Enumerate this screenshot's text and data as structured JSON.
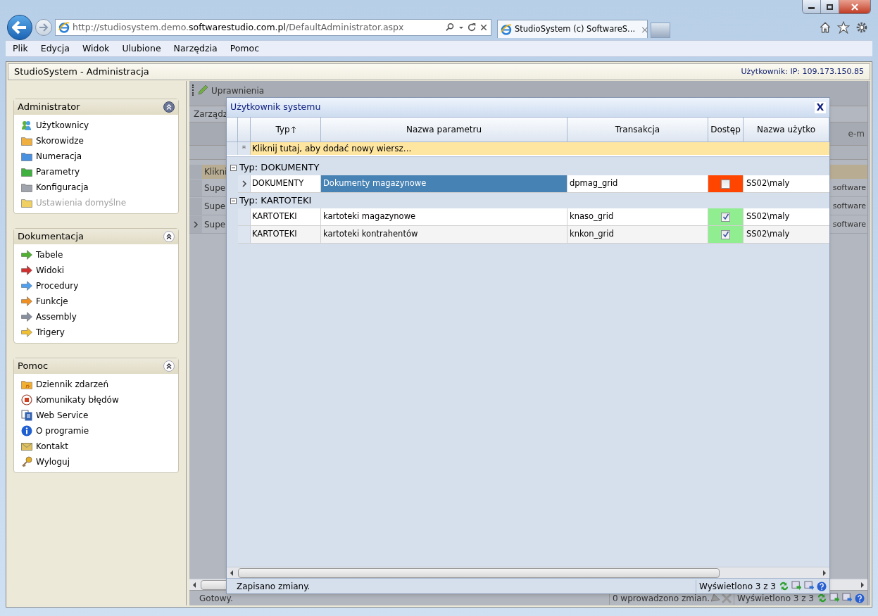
{
  "browser": {
    "address": {
      "prefix": "http://studiosystem.demo.",
      "domain": "softwarestudio.com.pl",
      "suffix": "/DefaultAdministrator.aspx"
    },
    "tab_title": "StudioSystem (c) SoftwareS...",
    "tab_close": "×",
    "menu": [
      "Plik",
      "Edycja",
      "Widok",
      "Ulubione",
      "Narzędzia",
      "Pomoc"
    ]
  },
  "app": {
    "title": "StudioSystem - Administracja",
    "user_info": "Użytkownik: IP: 109.173.150.85"
  },
  "sidebar": {
    "panels": [
      {
        "title": "Administrator",
        "highlighted": true,
        "items": [
          {
            "label": "Użytkownicy",
            "kind": "users",
            "color": "#4aa0e0",
            "disabled": false
          },
          {
            "label": "Skorowidze",
            "kind": "folder",
            "color": "#f0b040",
            "disabled": false
          },
          {
            "label": "Numeracja",
            "kind": "folder",
            "color": "#4a90e0",
            "disabled": false
          },
          {
            "label": "Parametry",
            "kind": "folder",
            "color": "#40b040",
            "disabled": false
          },
          {
            "label": "Konfiguracja",
            "kind": "folder",
            "color": "#a0a4ac",
            "disabled": false
          },
          {
            "label": "Ustawienia domyślne",
            "kind": "folder",
            "color": "#f0d060",
            "disabled": true
          }
        ]
      },
      {
        "title": "Dokumentacja",
        "highlighted": false,
        "items": [
          {
            "label": "Tabele",
            "kind": "arrow",
            "color": "#50b030",
            "disabled": false
          },
          {
            "label": "Widoki",
            "kind": "arrow",
            "color": "#d03030",
            "disabled": false
          },
          {
            "label": "Procedury",
            "kind": "arrow",
            "color": "#50a0f0",
            "disabled": false
          },
          {
            "label": "Funkcje",
            "kind": "arrow",
            "color": "#f09020",
            "disabled": false
          },
          {
            "label": "Assembly",
            "kind": "arrow",
            "color": "#8890a0",
            "disabled": false
          },
          {
            "label": "Trigery",
            "kind": "arrow",
            "color": "#f0c030",
            "disabled": false
          }
        ]
      },
      {
        "title": "Pomoc",
        "highlighted": false,
        "items": [
          {
            "label": "Dziennik zdarzeń",
            "kind": "feed",
            "color": "#f0b030",
            "disabled": false
          },
          {
            "label": "Komunikaty błędów",
            "kind": "stop",
            "color": "#d04020",
            "disabled": false
          },
          {
            "label": "Web Service",
            "kind": "pages",
            "color": "#3060b0",
            "disabled": false
          },
          {
            "label": "O programie",
            "kind": "info",
            "color": "#2060d0",
            "disabled": false
          },
          {
            "label": "Kontakt",
            "kind": "mail",
            "color": "#e0c060",
            "disabled": false
          },
          {
            "label": "Wyloguj",
            "kind": "key",
            "color": "#e0b020",
            "disabled": false
          }
        ]
      }
    ]
  },
  "background_grid": {
    "toolbar_button": "Uprawnienia",
    "group_text": "Zarządz",
    "header_text": "e-m",
    "new_row_text": "Klikni",
    "rows": [
      {
        "column_1": "Supe",
        "column_2": "software",
        "current": false
      },
      {
        "column_1": "Supe",
        "column_2": "software",
        "current": false
      },
      {
        "column_1": "Supe",
        "column_2": "software",
        "current": true
      }
    ],
    "status": "Gotowy.",
    "changes": "0 wprowadzono zmian.",
    "count": "Wyświetlono 3 z 3"
  },
  "dialog": {
    "title": "Użytkownik systemu",
    "close": "X",
    "columns": [
      {
        "label": "Typ",
        "sorted": true
      },
      {
        "label": "Nazwa parametru",
        "sorted": false
      },
      {
        "label": "Transakcja",
        "sorted": false
      },
      {
        "label": "Dostęp",
        "sorted": false
      },
      {
        "label": "Nazwa użytko",
        "sorted": false
      }
    ],
    "new_row_marker": "*",
    "new_row_text": "Kliknij tutaj, aby dodać nowy wiersz...",
    "groups": [
      {
        "label": "Typ: DOKUMENTY",
        "expanded": true,
        "rows": [
          {
            "type": "DOKUMENTY",
            "name": "Dokumenty magazynowe",
            "transaction": "dpmag_grid",
            "access": false,
            "user": "SS02\\maly",
            "current": true,
            "name_selected": true
          }
        ]
      },
      {
        "label": "Typ: KARTOTEKI",
        "expanded": true,
        "rows": [
          {
            "type": "KARTOTEKI",
            "name": "kartoteki magazynowe",
            "transaction": "knaso_grid",
            "access": true,
            "user": "SS02\\maly",
            "current": false,
            "name_selected": false
          },
          {
            "type": "KARTOTEKI",
            "name": "kartoteki kontrahentów",
            "transaction": "knkon_grid",
            "access": true,
            "user": "SS02\\maly",
            "current": false,
            "name_selected": false
          }
        ]
      }
    ],
    "status": "Zapisano zmiany.",
    "count": "Wyświetlono 3 z 3"
  }
}
